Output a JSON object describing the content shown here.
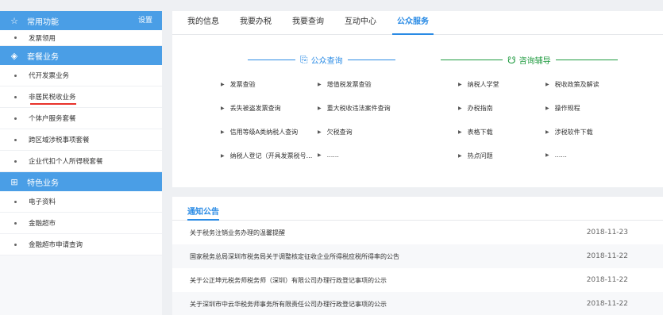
{
  "sidebar": {
    "common": {
      "icon": "star-icon",
      "title": "常用功能",
      "settings": "设置",
      "items": [
        "发票领用"
      ]
    },
    "package": {
      "icon": "layers-icon",
      "title": "套餐业务",
      "items": [
        "代开发票业务",
        "非居民税收业务",
        "个体户服务套餐",
        "跨区域涉税事项套餐",
        "企业代扣个人所得税套餐"
      ]
    },
    "special": {
      "icon": "grid-icon",
      "title": "特色业务",
      "items": [
        "电子资料",
        "金融超市",
        "金融超市申请查询"
      ]
    }
  },
  "tabs": [
    "我的信息",
    "我要办税",
    "我要查询",
    "互动中心",
    "公众服务"
  ],
  "active_tab": "公众服务",
  "query": {
    "title": "公众查询",
    "icon": "search-doc-icon",
    "links": [
      "发票查验",
      "增值税发票查验",
      "丢失被盗发票查询",
      "重大税收违法案件查询",
      "信用等级A类纳税人查询",
      "欠税查询",
      "纳税人登记（开具发票税号...",
      "......"
    ]
  },
  "consult": {
    "title": "咨询辅导",
    "icon": "consult-icon",
    "links": [
      "纳税人学堂",
      "税收政策及解读",
      "办税指南",
      "操作规程",
      "表格下载",
      "涉税软件下载",
      "热点问题",
      "......"
    ]
  },
  "notice": {
    "title": "通知公告",
    "rows": [
      {
        "text": "关于税务注销业务办理的温馨提醒",
        "date": "2018-11-23"
      },
      {
        "text": "国家税务总局深圳市税务局关于调整核定征收企业所得税应税所得率的公告",
        "date": "2018-11-22"
      },
      {
        "text": "关于公正坤元税务师税务师（深圳）有限公司办理行政登记事项的公示",
        "date": "2018-11-22"
      },
      {
        "text": "关于深圳市中云华税务师事务所有限责任公司办理行政登记事项的公示",
        "date": "2018-11-22"
      }
    ]
  },
  "colors": {
    "accent_blue": "#2a8be5",
    "sidebar_header": "#4a9ee6",
    "consult_green": "#1d9a3e",
    "active_underline": "#e8322b"
  }
}
